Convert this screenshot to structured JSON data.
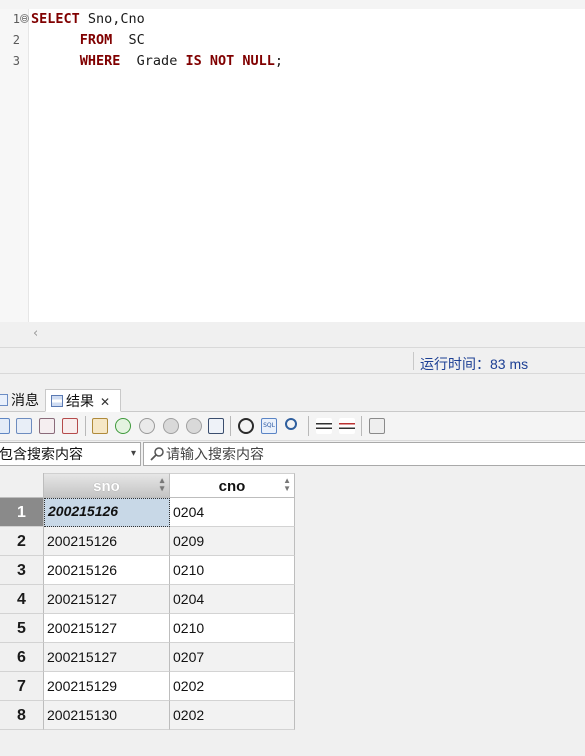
{
  "editor": {
    "line_numbers": [
      "1",
      "2",
      "3"
    ],
    "fold_marker": "⊖",
    "lines": [
      {
        "kw1": "SELECT",
        "rest1": " Sno,Cno",
        "kw2": "",
        "rest2": "",
        "kw3": "",
        "rest3": ""
      },
      {
        "indent": "      ",
        "kw1": "FROM",
        "rest1": "  SC",
        "kw2": "",
        "rest2": "",
        "kw3": "",
        "rest3": ""
      },
      {
        "indent": "      ",
        "kw1": "WHERE",
        "rest1": "  Grade ",
        "kw2": "IS",
        "rest2": " ",
        "kw3": "NOT NULL",
        "rest3": ";"
      }
    ],
    "scroll_arrow": "‹"
  },
  "status": {
    "run_time": "运行时间：83 ms"
  },
  "tabs": [
    {
      "label": "消息",
      "icon": "message-icon"
    },
    {
      "label": "结果",
      "icon": "grid-icon",
      "close": "✕"
    }
  ],
  "toolbar": {
    "icons": [
      "export-icon",
      "grid-view-icon",
      "edit-icon",
      "form-view-icon",
      "paste-icon",
      "add-row-icon",
      "delete-row-icon",
      "commit-icon",
      "cancel-icon",
      "window-icon",
      "refresh-icon",
      "sql-icon",
      "find-icon",
      "expand-icon",
      "collapse-icon",
      "report-icon"
    ]
  },
  "search": {
    "filter_label": "包含搜索内容",
    "filter_caret": "▾",
    "placeholder": "请输入搜索内容"
  },
  "table": {
    "columns": [
      "sno",
      "cno"
    ],
    "rows": [
      {
        "n": "1",
        "sno": "200215126",
        "cno": "0204"
      },
      {
        "n": "2",
        "sno": "200215126",
        "cno": "0209"
      },
      {
        "n": "3",
        "sno": "200215126",
        "cno": "0210"
      },
      {
        "n": "4",
        "sno": "200215127",
        "cno": "0204"
      },
      {
        "n": "5",
        "sno": "200215127",
        "cno": "0210"
      },
      {
        "n": "6",
        "sno": "200215127",
        "cno": "0207"
      },
      {
        "n": "7",
        "sno": "200215129",
        "cno": "0202"
      },
      {
        "n": "8",
        "sno": "200215130",
        "cno": "0202"
      }
    ]
  },
  "colors": {
    "keyword": "#800000",
    "status_text": "#1c3f94",
    "selected_cell": "#c8d8e7"
  }
}
